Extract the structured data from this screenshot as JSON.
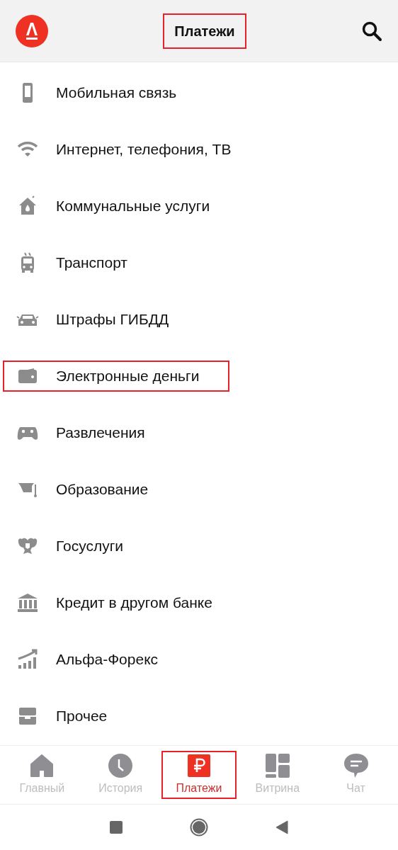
{
  "header": {
    "title": "Платежи",
    "title_highlighted": true
  },
  "categories": [
    {
      "label": "Мобильная связь",
      "highlighted": false
    },
    {
      "label": "Интернет, телефония, ТВ",
      "highlighted": false
    },
    {
      "label": "Коммунальные услуги",
      "highlighted": false
    },
    {
      "label": "Транспорт",
      "highlighted": false
    },
    {
      "label": "Штрафы ГИБДД",
      "highlighted": false
    },
    {
      "label": "Электронные деньги",
      "highlighted": true
    },
    {
      "label": "Развлечения",
      "highlighted": false
    },
    {
      "label": "Образование",
      "highlighted": false
    },
    {
      "label": "Госуслуги",
      "highlighted": false
    },
    {
      "label": "Кредит в другом банке",
      "highlighted": false
    },
    {
      "label": "Альфа-Форекс",
      "highlighted": false
    },
    {
      "label": "Прочее",
      "highlighted": false
    }
  ],
  "tabs": [
    {
      "label": "Главный",
      "selected": false,
      "highlighted": false
    },
    {
      "label": "История",
      "selected": false,
      "highlighted": false
    },
    {
      "label": "Платежи",
      "selected": true,
      "highlighted": true
    },
    {
      "label": "Витрина",
      "selected": false,
      "highlighted": false
    },
    {
      "label": "Чат",
      "selected": false,
      "highlighted": false
    }
  ]
}
